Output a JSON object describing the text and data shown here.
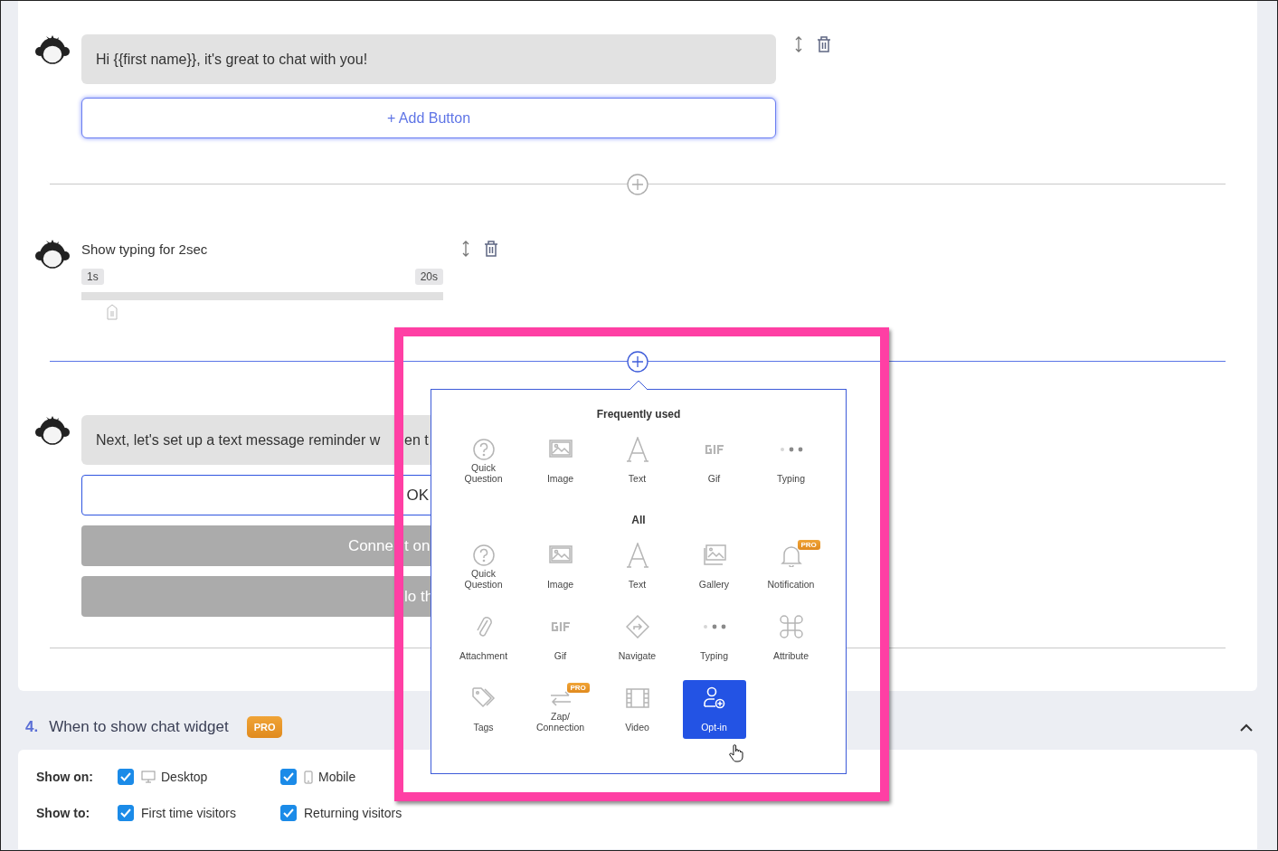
{
  "messages": [
    {
      "kind": "text",
      "text": "Hi {{first name}}, it's great to chat with you!",
      "actions": true,
      "buttons": [
        {
          "kind": "add",
          "label": "+ Add Button"
        }
      ],
      "divider": {
        "kind": "plus",
        "active": false
      }
    },
    {
      "kind": "typing",
      "text": "Show typing for 2sec",
      "min": "1s",
      "max": "20s",
      "level": 0.05,
      "actions": true,
      "divider": {
        "kind": "plus",
        "active": true
      }
    },
    {
      "kind": "text",
      "text": "Next, let's set up a text message reminder w",
      "text_after": "en t",
      "actions": false,
      "buttons": [
        {
          "kind": "input",
          "label": "OK"
        },
        {
          "kind": "option",
          "before": "Conne",
          "after": "t on"
        },
        {
          "kind": "option",
          "after": "lo th"
        }
      ],
      "divider": {
        "kind": "line"
      }
    }
  ],
  "popup": {
    "sections": [
      {
        "title": "Frequently used",
        "items": [
          {
            "kind": "question",
            "label": "Quick Question",
            "selected": false
          },
          {
            "kind": "image",
            "label": "Image",
            "selected": false
          },
          {
            "kind": "text",
            "label": "Text",
            "selected": false
          },
          {
            "kind": "gif",
            "label": "Gif",
            "selected": false
          },
          {
            "kind": "typing",
            "label": "Typing",
            "selected": false
          }
        ]
      },
      {
        "title": "All",
        "items": [
          {
            "kind": "question",
            "label": "Quick Question",
            "selected": false
          },
          {
            "kind": "image",
            "label": "Image",
            "selected": false
          },
          {
            "kind": "text",
            "label": "Text",
            "selected": false
          },
          {
            "kind": "gallery",
            "label": "Gallery",
            "selected": false
          },
          {
            "kind": "bell",
            "label": "Notification",
            "badge": "PRO",
            "selected": false
          },
          {
            "kind": "clip",
            "label": "Attachment",
            "selected": false
          },
          {
            "kind": "gif",
            "label": "Gif",
            "selected": false
          },
          {
            "kind": "navigate",
            "label": "Navigate",
            "selected": false
          },
          {
            "kind": "typing",
            "label": "Typing",
            "selected": false
          },
          {
            "kind": "command",
            "label": "Attribute",
            "selected": false
          },
          {
            "kind": "tag",
            "label": "Tags",
            "selected": false
          },
          {
            "kind": "zap",
            "label": "Zap/ Connection",
            "badge": "PRO",
            "selected": false
          },
          {
            "kind": "film",
            "label": "Video",
            "selected": false
          },
          {
            "kind": "optin",
            "label": "Opt-in",
            "selected": true
          }
        ]
      }
    ]
  },
  "section": {
    "number": "4.",
    "title": "When to show chat widget",
    "badge": "PRO",
    "expanded": true,
    "rows": [
      {
        "label": "Show on:",
        "options": [
          {
            "kind": "desktop",
            "label": "Desktop",
            "checked": true
          },
          {
            "kind": "mobile",
            "label": "Mobile",
            "checked": true
          }
        ]
      },
      {
        "label": "Show to:",
        "options": [
          {
            "kind": "plain",
            "label": "First time visitors",
            "checked": true
          },
          {
            "kind": "plain",
            "label": "Returning visitors",
            "checked": true
          }
        ]
      }
    ]
  }
}
